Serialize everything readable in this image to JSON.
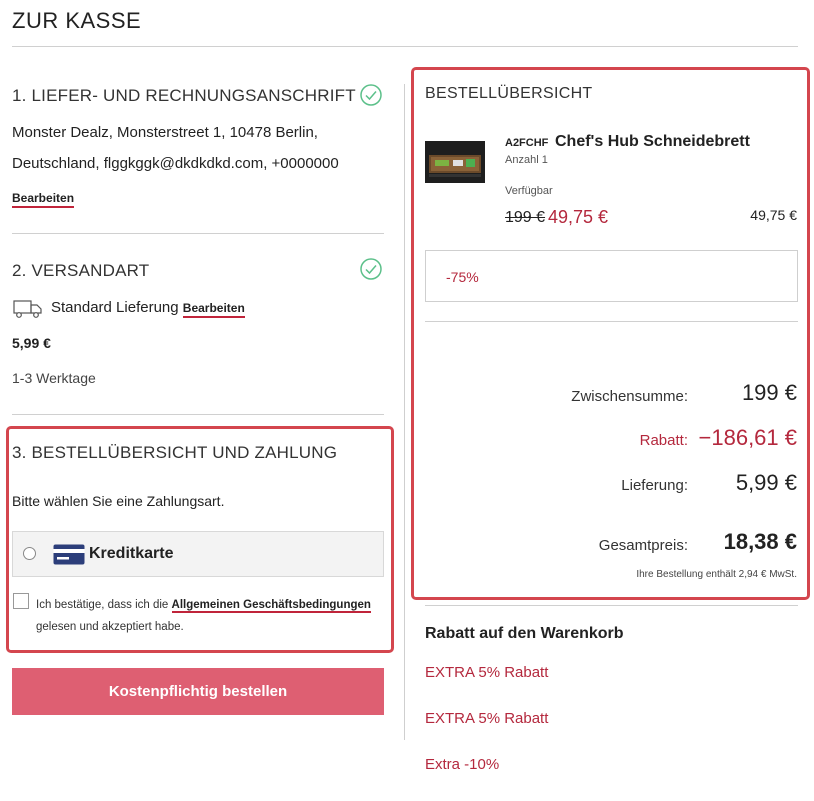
{
  "page": {
    "title": "ZUR KASSE"
  },
  "address": {
    "title": "1. LIEFER- UND RECHNUNGSANSCHRIFT",
    "line1": "Monster Dealz, Monsterstreet 1, 10478 Berlin,",
    "line2": "Deutschland, flggkggk@dkdkdkd.com, +0000000",
    "edit_label": "Bearbeiten",
    "status_icon": "check-circle-icon"
  },
  "shipping": {
    "title": "2. VERSANDART",
    "method": "Standard Lieferung",
    "edit_label": "Bearbeiten",
    "price": "5,99 €",
    "duration": "1-3 Werktage",
    "icon": "truck-icon"
  },
  "payment": {
    "title": "3. BESTELLÜBERSICHT UND ZAHLUNG",
    "prompt": "Bitte wählen Sie eine Zahlungsart.",
    "option_label": "Kreditkarte",
    "option_icon": "credit-card-icon",
    "agb_prefix": "Ich bestätige, dass ich die",
    "agb_link": "Allgemeinen Geschäftsbedingungen",
    "agb_suffix": "gelesen und akzeptiert habe.",
    "submit_label": "Kostenpflichtig bestellen"
  },
  "summary": {
    "title": "BESTELLÜBERSICHT",
    "product": {
      "code": "A2FCHF",
      "name": "Chef's Hub Schneidebrett",
      "quantity": "Anzahl 1",
      "availability": "Verfügbar",
      "old_price": "199 €",
      "new_price": "49,75 €",
      "line_total": "49,75 €"
    },
    "discount_badge": "-75%",
    "subtotal_label": "Zwischensumme:",
    "subtotal_value": "199 €",
    "discount_label": "Rabatt:",
    "discount_value": "−186,61 €",
    "delivery_label": "Lieferung:",
    "delivery_value": "5,99 €",
    "total_label": "Gesamtpreis:",
    "total_value": "18,38 €",
    "tax_note": "Ihre Bestellung enthält 2,94 € MwSt."
  },
  "cart_discounts": {
    "title": "Rabatt auf den Warenkorb",
    "items": [
      "EXTRA 5% Rabatt",
      "EXTRA 5% Rabatt",
      "Extra -10%"
    ]
  },
  "colors": {
    "accent_red": "#b4283d",
    "highlight_border": "#d4464e",
    "button_bg": "#de5f72",
    "check_green": "#5cc08a"
  }
}
